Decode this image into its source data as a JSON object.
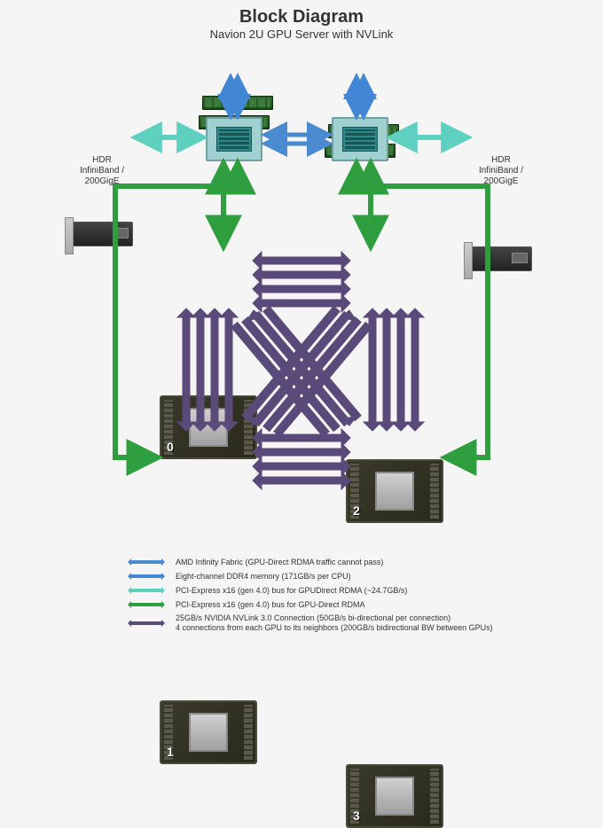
{
  "title": "Block Diagram",
  "subtitle": "Navion 2U GPU Server with NVLink",
  "nic_left_label": "HDR\nInfiniBand /\n200GigE",
  "nic_right_label": "HDR\nInfiniBand /\n200GigE",
  "gpu_numbers": [
    "0",
    "2",
    "1",
    "3"
  ],
  "colors": {
    "infinity_fabric": "#4a8ad0",
    "ddr4": "#4287d6",
    "pcie_rdma_nic": "#5ed0c0",
    "pcie_rdma_gpu": "#2e9e3e",
    "nvlink": "#5a4a7a"
  },
  "legend": [
    {
      "color": "infinity_fabric",
      "text": "AMD Infinity Fabric (GPU-Direct RDMA traffic cannot pass)"
    },
    {
      "color": "ddr4",
      "text": "Eight-channel DDR4 memory (171GB/s per CPU)"
    },
    {
      "color": "pcie_rdma_nic",
      "text": "PCI-Express x16 (gen 4.0) bus for GPUDirect RDMA (~24.7GB/s)"
    },
    {
      "color": "pcie_rdma_gpu",
      "text": "PCI-Express x16 (gen 4.0) bus for GPU-Direct RDMA"
    },
    {
      "color": "nvlink",
      "text": "25GB/s NVIDIA NVLink 3.0 Connection (50GB/s bi-directional per connection)\n4 connections from each GPU to its neighbors (200GB/s bidirectional BW between GPUs)"
    }
  ]
}
